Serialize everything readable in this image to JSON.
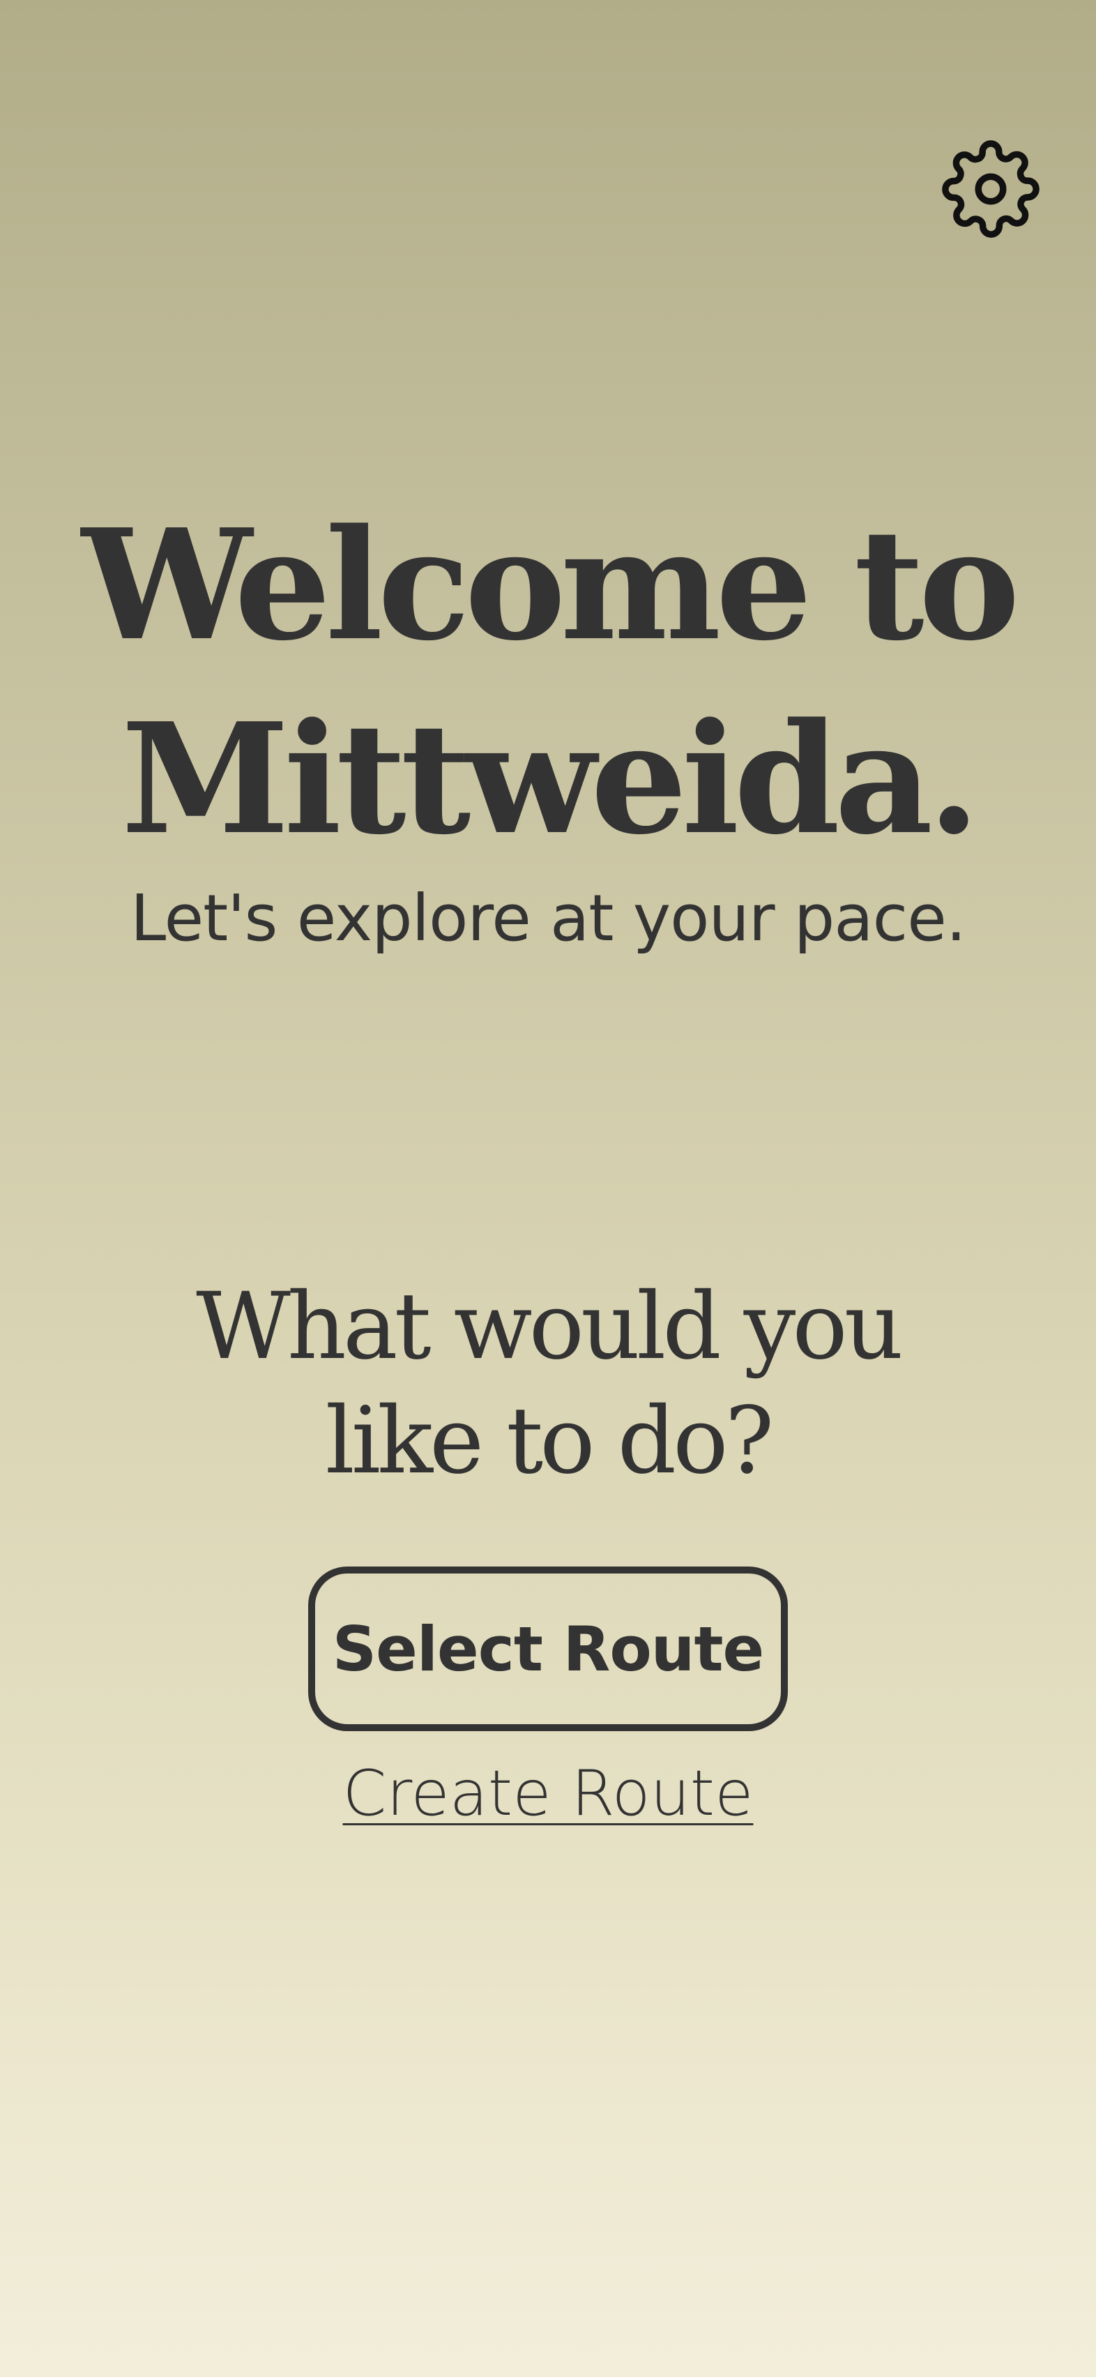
{
  "header": {
    "settings_icon": "gear-icon"
  },
  "hero": {
    "title_line1": "Welcome to",
    "title_line2": "Mittweida.",
    "tagline": "Let's explore at your pace."
  },
  "prompt": {
    "question_line1": "What would you",
    "question_line2": "like to do?"
  },
  "actions": {
    "select_route_label": "Select Route",
    "create_route_label": "Create Route"
  },
  "colors": {
    "text": "#333333",
    "gradient_top": "#b2ad89",
    "gradient_bottom": "#f3eeda"
  }
}
